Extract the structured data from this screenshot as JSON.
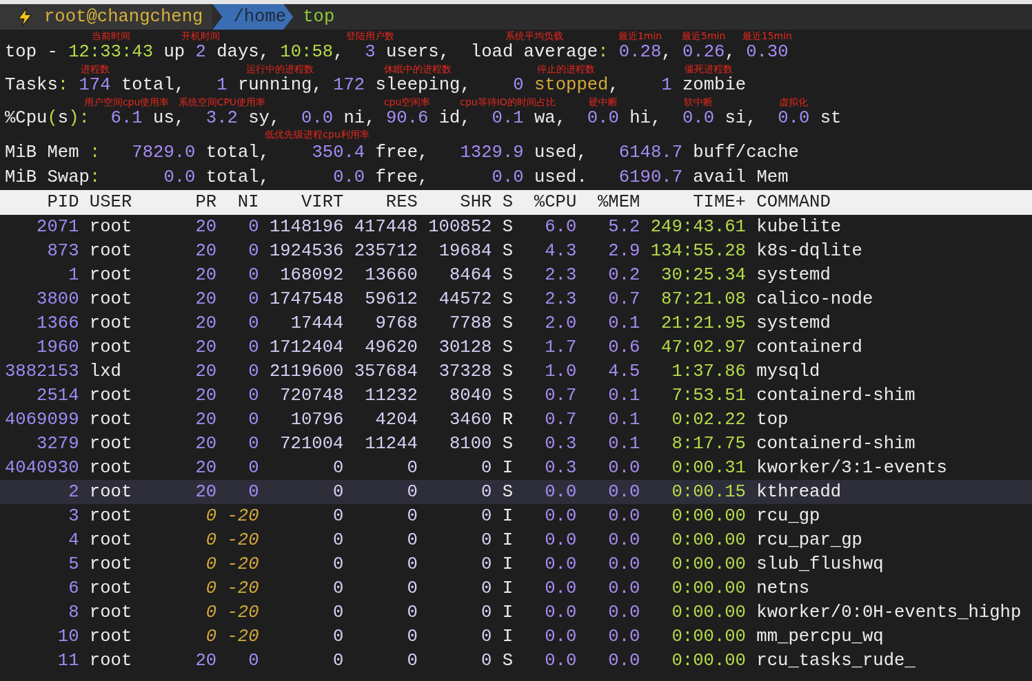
{
  "prompt": {
    "user": "root@changcheng",
    "path": "/home",
    "command": "top"
  },
  "summary": [
    {
      "segments": [
        {
          "text": "top - ",
          "kind": "plain"
        },
        {
          "text": "12:33:43",
          "kind": "time",
          "note": "当前时间"
        },
        {
          "text": " up ",
          "kind": "plain"
        },
        {
          "text": "2",
          "kind": "num",
          "note": "开机时间"
        },
        {
          "text": " days, ",
          "kind": "plain"
        },
        {
          "text": "10:58",
          "kind": "time"
        },
        {
          "text": ",  ",
          "kind": "plain"
        },
        {
          "text": "3",
          "kind": "num",
          "note": "登陆用户数"
        },
        {
          "text": " users,  ",
          "kind": "plain"
        },
        {
          "text": "load average",
          "kind": "plain",
          "note": "系统平均负载"
        },
        {
          "text": ": ",
          "kind": "punct"
        },
        {
          "text": "0.28",
          "kind": "num",
          "note": "最近1min"
        },
        {
          "text": ", ",
          "kind": "plain"
        },
        {
          "text": "0.26",
          "kind": "num",
          "note": "最近5min"
        },
        {
          "text": ", ",
          "kind": "plain"
        },
        {
          "text": "0.30",
          "kind": "num",
          "note": "最近15min"
        }
      ]
    },
    {
      "segments": [
        {
          "text": "Tasks",
          "kind": "plain"
        },
        {
          "text": ": ",
          "kind": "punct"
        },
        {
          "text": "174",
          "kind": "num",
          "note": "进程数"
        },
        {
          "text": " total,   ",
          "kind": "plain"
        },
        {
          "text": "1",
          "kind": "num"
        },
        {
          "text": " running, ",
          "kind": "plain",
          "note": "运行中的进程数"
        },
        {
          "text": "172",
          "kind": "num"
        },
        {
          "text": " sleeping,",
          "kind": "plain",
          "note": "休眠中的进程数"
        },
        {
          "text": "    0",
          "kind": "num"
        },
        {
          "text": " stopped",
          "kind": "warn",
          "note": "停止的进程数"
        },
        {
          "text": ",    ",
          "kind": "plain"
        },
        {
          "text": "1",
          "kind": "num"
        },
        {
          "text": " zombie",
          "kind": "plain",
          "note": "僵死进程数"
        }
      ]
    },
    {
      "segments": [
        {
          "text": "%Cpu",
          "kind": "plain"
        },
        {
          "text": "(",
          "kind": "punct"
        },
        {
          "text": "s",
          "kind": "plain"
        },
        {
          "text": "):  ",
          "kind": "punct"
        },
        {
          "text": "6.1",
          "kind": "num",
          "note": "用户空间cpu使用率"
        },
        {
          "text": " us,  ",
          "kind": "plain"
        },
        {
          "text": "3.2",
          "kind": "num",
          "note": "系统空间CPU使用率"
        },
        {
          "text": " sy,  ",
          "kind": "plain"
        },
        {
          "text": "0.0",
          "kind": "num",
          "note": "低优先级进程cpu利用率",
          "note_below": true
        },
        {
          "text": " ni, ",
          "kind": "plain"
        },
        {
          "text": "90.6",
          "kind": "num",
          "note": "cpu空闲率"
        },
        {
          "text": " id,  ",
          "kind": "plain"
        },
        {
          "text": "0.1",
          "kind": "num",
          "note": "cpu等待IO的时间占比"
        },
        {
          "text": " wa,  ",
          "kind": "plain"
        },
        {
          "text": "0.0",
          "kind": "num",
          "note": "硬中断"
        },
        {
          "text": " hi,  ",
          "kind": "plain"
        },
        {
          "text": "0.0",
          "kind": "num",
          "note": "软中断"
        },
        {
          "text": " si,  ",
          "kind": "plain"
        },
        {
          "text": "0.0",
          "kind": "num",
          "note": "虚拟化"
        },
        {
          "text": " st",
          "kind": "plain"
        }
      ]
    },
    {
      "segments": [
        {
          "text": "MiB Mem ",
          "kind": "plain"
        },
        {
          "text": ":   ",
          "kind": "punct"
        },
        {
          "text": "7829.0",
          "kind": "num"
        },
        {
          "text": " total,    ",
          "kind": "plain"
        },
        {
          "text": "350.4",
          "kind": "num"
        },
        {
          "text": " free,   ",
          "kind": "plain"
        },
        {
          "text": "1329.9",
          "kind": "num"
        },
        {
          "text": " used,   ",
          "kind": "plain"
        },
        {
          "text": "6148.7",
          "kind": "num"
        },
        {
          "text": " buff/cache",
          "kind": "plain"
        }
      ]
    },
    {
      "segments": [
        {
          "text": "MiB Swap",
          "kind": "plain"
        },
        {
          "text": ":      ",
          "kind": "punct"
        },
        {
          "text": "0.0",
          "kind": "num"
        },
        {
          "text": " total,      ",
          "kind": "plain"
        },
        {
          "text": "0.0",
          "kind": "num"
        },
        {
          "text": " free,      ",
          "kind": "plain"
        },
        {
          "text": "0.0",
          "kind": "num"
        },
        {
          "text": " used.   ",
          "kind": "plain"
        },
        {
          "text": "6190.7",
          "kind": "num"
        },
        {
          "text": " avail Mem",
          "kind": "plain"
        }
      ]
    }
  ],
  "table": {
    "columns": [
      "PID",
      "USER",
      "PR",
      "NI",
      "VIRT",
      "RES",
      "SHR",
      "S",
      "%CPU",
      "%MEM",
      "TIME+",
      "COMMAND"
    ],
    "rows": [
      {
        "cells": [
          "2071",
          "root",
          "20",
          "0",
          "1148196",
          "417448",
          "100852",
          "S",
          "6.0",
          "5.2",
          "249:43.61",
          "kubelite"
        ],
        "high_priority": false,
        "selected": false
      },
      {
        "cells": [
          "873",
          "root",
          "20",
          "0",
          "1924536",
          "235712",
          "19684",
          "S",
          "4.3",
          "2.9",
          "134:55.28",
          "k8s-dqlite"
        ],
        "high_priority": false,
        "selected": false
      },
      {
        "cells": [
          "1",
          "root",
          "20",
          "0",
          "168092",
          "13660",
          "8464",
          "S",
          "2.3",
          "0.2",
          "30:25.34",
          "systemd"
        ],
        "high_priority": false,
        "selected": false
      },
      {
        "cells": [
          "3800",
          "root",
          "20",
          "0",
          "1747548",
          "59612",
          "44572",
          "S",
          "2.3",
          "0.7",
          "87:21.08",
          "calico-node"
        ],
        "high_priority": false,
        "selected": false
      },
      {
        "cells": [
          "1366",
          "root",
          "20",
          "0",
          "17444",
          "9768",
          "7788",
          "S",
          "2.0",
          "0.1",
          "21:21.95",
          "systemd"
        ],
        "high_priority": false,
        "selected": false
      },
      {
        "cells": [
          "1960",
          "root",
          "20",
          "0",
          "1712404",
          "49620",
          "30128",
          "S",
          "1.7",
          "0.6",
          "47:02.97",
          "containerd"
        ],
        "high_priority": false,
        "selected": false
      },
      {
        "cells": [
          "3882153",
          "lxd",
          "20",
          "0",
          "2119600",
          "357684",
          "37328",
          "S",
          "1.0",
          "4.5",
          "1:37.86",
          "mysqld"
        ],
        "high_priority": false,
        "selected": false
      },
      {
        "cells": [
          "2514",
          "root",
          "20",
          "0",
          "720748",
          "11232",
          "8040",
          "S",
          "0.7",
          "0.1",
          "7:53.51",
          "containerd-shim"
        ],
        "high_priority": false,
        "selected": false
      },
      {
        "cells": [
          "4069099",
          "root",
          "20",
          "0",
          "10796",
          "4204",
          "3460",
          "R",
          "0.7",
          "0.1",
          "0:02.22",
          "top"
        ],
        "high_priority": false,
        "selected": false
      },
      {
        "cells": [
          "3279",
          "root",
          "20",
          "0",
          "721004",
          "11244",
          "8100",
          "S",
          "0.3",
          "0.1",
          "8:17.75",
          "containerd-shim"
        ],
        "high_priority": false,
        "selected": false
      },
      {
        "cells": [
          "4040930",
          "root",
          "20",
          "0",
          "0",
          "0",
          "0",
          "I",
          "0.3",
          "0.0",
          "0:00.31",
          "kworker/3:1-events"
        ],
        "high_priority": false,
        "selected": false
      },
      {
        "cells": [
          "2",
          "root",
          "20",
          "0",
          "0",
          "0",
          "0",
          "S",
          "0.0",
          "0.0",
          "0:00.15",
          "kthreadd"
        ],
        "high_priority": false,
        "selected": true
      },
      {
        "cells": [
          "3",
          "root",
          "0",
          "-20",
          "0",
          "0",
          "0",
          "I",
          "0.0",
          "0.0",
          "0:00.00",
          "rcu_gp"
        ],
        "high_priority": true,
        "selected": false
      },
      {
        "cells": [
          "4",
          "root",
          "0",
          "-20",
          "0",
          "0",
          "0",
          "I",
          "0.0",
          "0.0",
          "0:00.00",
          "rcu_par_gp"
        ],
        "high_priority": true,
        "selected": false
      },
      {
        "cells": [
          "5",
          "root",
          "0",
          "-20",
          "0",
          "0",
          "0",
          "I",
          "0.0",
          "0.0",
          "0:00.00",
          "slub_flushwq"
        ],
        "high_priority": true,
        "selected": false
      },
      {
        "cells": [
          "6",
          "root",
          "0",
          "-20",
          "0",
          "0",
          "0",
          "I",
          "0.0",
          "0.0",
          "0:00.00",
          "netns"
        ],
        "high_priority": true,
        "selected": false
      },
      {
        "cells": [
          "8",
          "root",
          "0",
          "-20",
          "0",
          "0",
          "0",
          "I",
          "0.0",
          "0.0",
          "0:00.00",
          "kworker/0:0H-events_highp"
        ],
        "high_priority": true,
        "selected": false
      },
      {
        "cells": [
          "10",
          "root",
          "0",
          "-20",
          "0",
          "0",
          "0",
          "I",
          "0.0",
          "0.0",
          "0:00.00",
          "mm_percpu_wq"
        ],
        "high_priority": true,
        "selected": false
      },
      {
        "cells": [
          "11",
          "root",
          "20",
          "0",
          "0",
          "0",
          "0",
          "S",
          "0.0",
          "0.0",
          "0:00.00",
          "rcu_tasks_rude_"
        ],
        "high_priority": false,
        "selected": false
      }
    ]
  }
}
